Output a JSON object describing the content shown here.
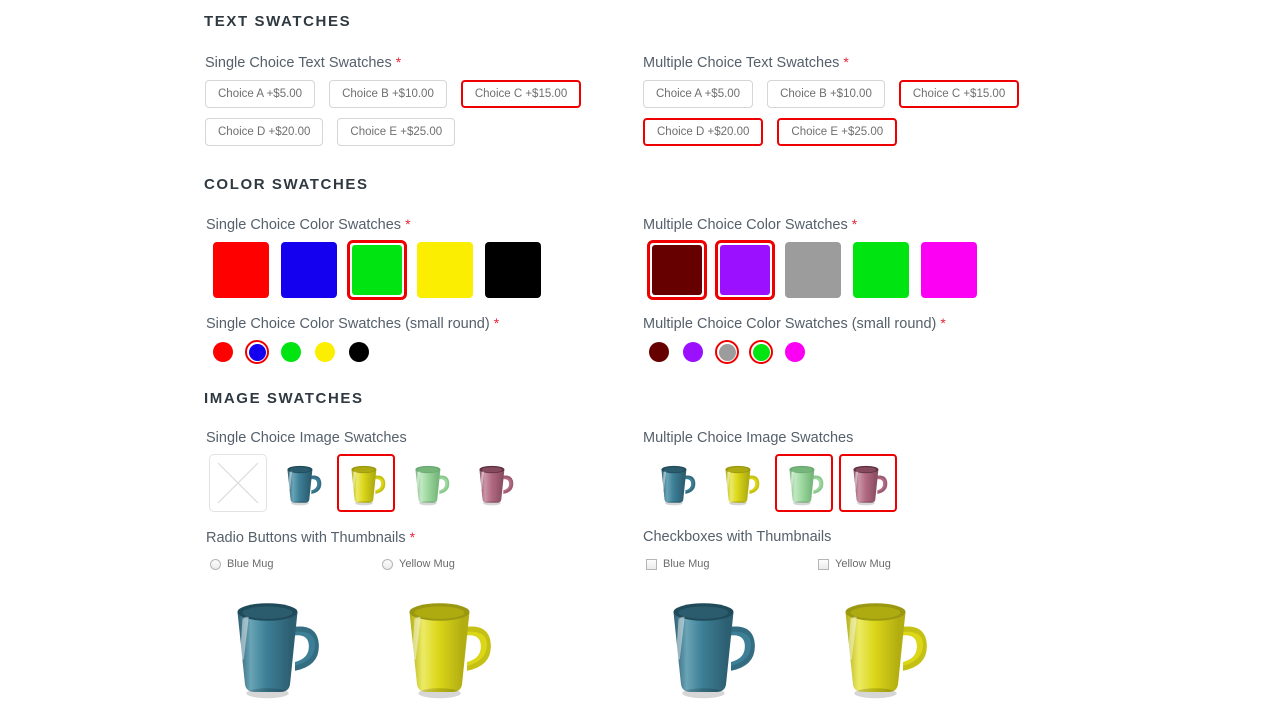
{
  "sections": {
    "text": {
      "title": "TEXT SWATCHES"
    },
    "color": {
      "title": "COLOR SWATCHES"
    },
    "image": {
      "title": "IMAGE SWATCHES"
    }
  },
  "labels": {
    "single_text": "Single Choice Text Swatches",
    "multi_text": "Multiple Choice Text Swatches",
    "single_color": "Single Choice Color Swatches",
    "multi_color": "Multiple Choice Color Swatches",
    "single_color_round": "Single Choice Color Swatches (small round)",
    "multi_color_round": "Multiple Choice Color Swatches (small round)",
    "single_image": "Single Choice Image Swatches",
    "multi_image": "Multiple Choice Image Swatches",
    "radio_thumbs": "Radio Buttons with Thumbnails",
    "checkbox_thumbs": "Checkboxes with Thumbnails",
    "required_marker": "*"
  },
  "text_swatches": {
    "single": [
      {
        "label": "Choice A +$5.00",
        "selected": false
      },
      {
        "label": "Choice B +$10.00",
        "selected": false
      },
      {
        "label": "Choice C +$15.00",
        "selected": true
      },
      {
        "label": "Choice D +$20.00",
        "selected": false
      },
      {
        "label": "Choice E +$25.00",
        "selected": false
      }
    ],
    "multiple": [
      {
        "label": "Choice A +$5.00",
        "selected": false
      },
      {
        "label": "Choice B +$10.00",
        "selected": false
      },
      {
        "label": "Choice C +$15.00",
        "selected": true
      },
      {
        "label": "Choice D +$20.00",
        "selected": true
      },
      {
        "label": "Choice E +$25.00",
        "selected": true
      }
    ]
  },
  "color_swatches": {
    "single_square": [
      {
        "name": "red",
        "color": "#fe0000",
        "selected": false
      },
      {
        "name": "blue",
        "color": "#1400ee",
        "selected": false
      },
      {
        "name": "green",
        "color": "#00e512",
        "selected": true
      },
      {
        "name": "yellow",
        "color": "#fbee00",
        "selected": false
      },
      {
        "name": "black",
        "color": "#000000",
        "selected": false
      }
    ],
    "multiple_square": [
      {
        "name": "maroon",
        "color": "#660000",
        "selected": true
      },
      {
        "name": "purple",
        "color": "#9b10fe",
        "selected": true
      },
      {
        "name": "gray",
        "color": "#9c9c9c",
        "selected": false
      },
      {
        "name": "green",
        "color": "#00e512",
        "selected": false
      },
      {
        "name": "magenta",
        "color": "#fb00f3",
        "selected": false
      }
    ],
    "single_round": [
      {
        "name": "red",
        "color": "#fe0000",
        "selected": false
      },
      {
        "name": "blue",
        "color": "#1400ee",
        "selected": true
      },
      {
        "name": "green",
        "color": "#00e512",
        "selected": false
      },
      {
        "name": "yellow",
        "color": "#fbee00",
        "selected": false
      },
      {
        "name": "black",
        "color": "#000000",
        "selected": false
      }
    ],
    "multiple_round": [
      {
        "name": "maroon",
        "color": "#660000",
        "selected": false
      },
      {
        "name": "purple",
        "color": "#9b10fe",
        "selected": false
      },
      {
        "name": "gray",
        "color": "#9c9c9c",
        "selected": true
      },
      {
        "name": "green",
        "color": "#00e512",
        "selected": true
      },
      {
        "name": "magenta",
        "color": "#fb00f3",
        "selected": false
      }
    ]
  },
  "image_swatches": {
    "single": [
      {
        "name": "missing-image",
        "mug": null,
        "selected": false
      },
      {
        "name": "blue-mug",
        "mug": "blue",
        "selected": false
      },
      {
        "name": "yellow-mug",
        "mug": "yellow",
        "selected": true
      },
      {
        "name": "green-mug",
        "mug": "green",
        "selected": false
      },
      {
        "name": "pink-mug",
        "mug": "pink",
        "selected": false
      }
    ],
    "multiple": [
      {
        "name": "blue-mug",
        "mug": "blue",
        "selected": false
      },
      {
        "name": "yellow-mug",
        "mug": "yellow",
        "selected": false
      },
      {
        "name": "green-mug",
        "mug": "green",
        "selected": true
      },
      {
        "name": "pink-mug",
        "mug": "pink",
        "selected": true
      }
    ]
  },
  "thumb_choices": {
    "radios": [
      {
        "label": "Blue Mug",
        "mug": "blue",
        "selected": false
      },
      {
        "label": "Yellow Mug",
        "mug": "yellow",
        "selected": false
      }
    ],
    "checkboxes": [
      {
        "label": "Blue Mug",
        "mug": "blue",
        "selected": false
      },
      {
        "label": "Yellow Mug",
        "mug": "yellow",
        "selected": false
      }
    ]
  },
  "colors": {
    "selected_border": "#ee0000",
    "heading": "#2f3941",
    "label": "#55606b",
    "required": "#e8243a",
    "swatch_border": "#d6d6d6"
  },
  "mug_palette": {
    "blue": {
      "body": "#3d7f96",
      "dark": "#2d5f72",
      "light": "#69a3b6",
      "rim": "#1f4a5a"
    },
    "yellow": {
      "body": "#dbd618",
      "dark": "#b2ae12",
      "light": "#ecea66",
      "rim": "#9a9710"
    },
    "green": {
      "body": "#9ed9a0",
      "dark": "#79b87d",
      "light": "#c3e8c4",
      "rim": "#6aa870"
    },
    "pink": {
      "body": "#b26b82",
      "dark": "#8d4f65",
      "light": "#cb95a6",
      "rim": "#5d2f40"
    }
  }
}
